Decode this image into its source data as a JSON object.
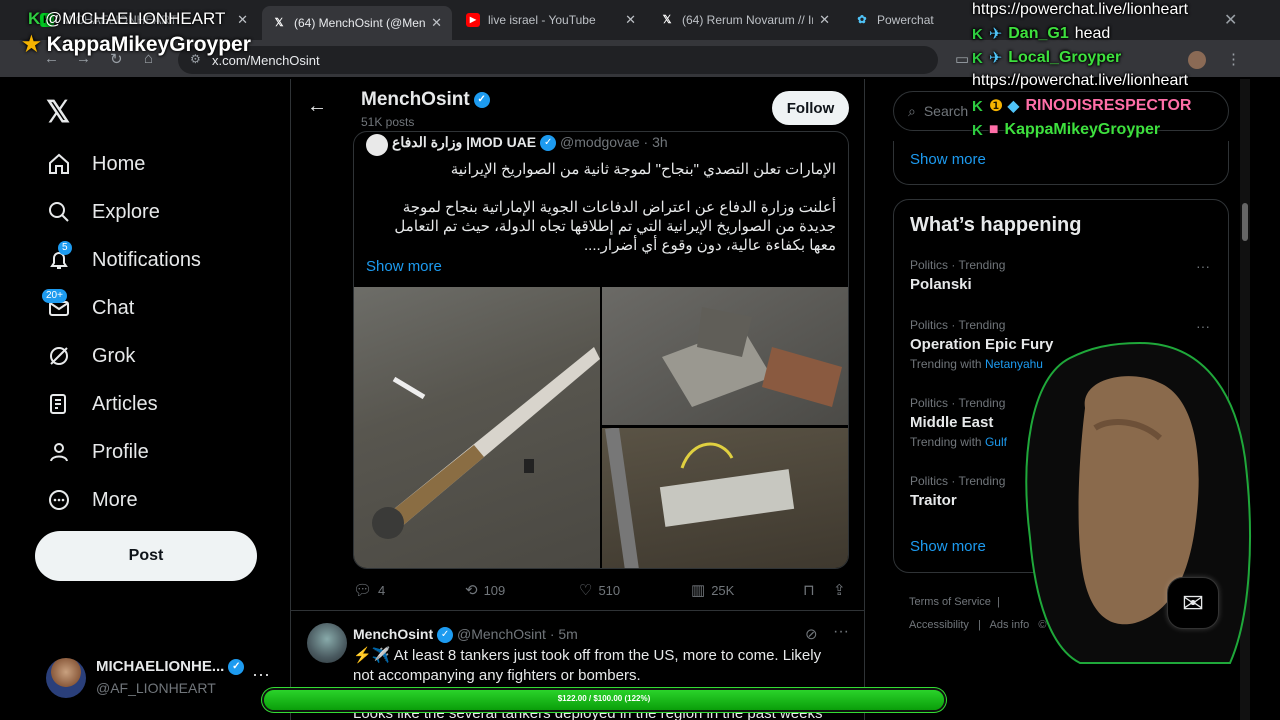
{
  "browser": {
    "tabs": [
      {
        "title": "MICHAELIONHEART",
        "active": false
      },
      {
        "title": "(64) MenchOsint (@Menc",
        "active": true
      },
      {
        "title": "live israel - YouTube",
        "active": false
      },
      {
        "title": "(64) Rerum Novarum // In",
        "active": false
      },
      {
        "title": "Powerchat",
        "active": false
      }
    ],
    "url": "x.com/MenchOsint"
  },
  "nav": {
    "items": [
      {
        "label": "Home"
      },
      {
        "label": "Explore"
      },
      {
        "label": "Notifications",
        "badge": "5"
      },
      {
        "label": "Chat",
        "badge": "20+"
      },
      {
        "label": "Grok"
      },
      {
        "label": "Articles"
      },
      {
        "label": "Profile"
      },
      {
        "label": "More"
      }
    ],
    "post_label": "Post",
    "account": {
      "name": "MICHAELIONHE...",
      "handle": "@AF_LIONHEART"
    }
  },
  "profile_header": {
    "name": "MenchOsint",
    "posts": "51K posts",
    "follow_label": "Follow"
  },
  "quote": {
    "author": "وزارة الدفاع |MOD UAE",
    "handle": "@modgovae",
    "time": "· 3h",
    "line1": "الإمارات تعلن التصدي \"بنجاح\" لموجة ثانية من الصواريخ الإيرانية",
    "line2": "أعلنت وزارة الدفاع عن اعتراض الدفاعات الجوية الإماراتية بنجاح لموجة جديدة من الصواريخ الإيرانية التي تم إطلاقها تجاه الدولة، حيث تم التعامل معها بكفاءة عالية، دون وقوع أي أضرار....",
    "show_more": "Show more"
  },
  "actions": {
    "replies": "4",
    "reposts": "109",
    "likes": "510",
    "views": "25K"
  },
  "tweet2": {
    "name": "MenchOsint",
    "handle": "@MenchOsint",
    "time": "· 5m",
    "text": "⚡✈️ At least 8 tankers just took off from the US, more to come. Likely not accompanying any fighters or bombers.",
    "text2": "Looks like the several tankers deployed in the region in the past weeks were"
  },
  "sidebar": {
    "search_placeholder": "Search",
    "show_more": "Show more",
    "whats_happening": "What’s happening",
    "trends": [
      {
        "category": "Politics · Trending",
        "title": "Polanski",
        "with_label": "",
        "with_link": ""
      },
      {
        "category": "Politics · Trending",
        "title": "Operation Epic Fury",
        "with_label": "Trending with",
        "with_link": "Netanyahu"
      },
      {
        "category": "Politics · Trending",
        "title": "Middle East",
        "with_label": "Trending with",
        "with_link": "Gulf"
      },
      {
        "category": "Politics · Trending",
        "title": "Traitor",
        "with_label": "",
        "with_link": ""
      }
    ],
    "show_more2": "Show more",
    "footer": {
      "tos": "Terms of Service",
      "access": "Accessibility",
      "ads": "Ads info",
      "copy": "© 202"
    }
  },
  "overlay": {
    "stream_user": "@MICHAELIONHEART",
    "stream_user2": "KappaMikeyGroyper",
    "chat": [
      {
        "text": "https://powerchat.live/lionheart"
      },
      {
        "user": "Dan_G1",
        "msg": "head"
      },
      {
        "user": "Local_Groyper",
        "msg": ""
      },
      {
        "text": "https://powerchat.live/lionheart"
      },
      {
        "user": "RINODISRESPECTOR",
        "msg": ""
      },
      {
        "user": "KappaMikeyGroyper",
        "msg": ""
      }
    ],
    "goal": {
      "label": "$122.00 / $100.00 (122%)",
      "progress": 1.0
    }
  },
  "colors": {
    "accent": "#1d9bf0",
    "bg": "#000000",
    "goal": "#22c922",
    "chat_pink": "#ff6fa8",
    "chat_green": "#3ee03e"
  }
}
